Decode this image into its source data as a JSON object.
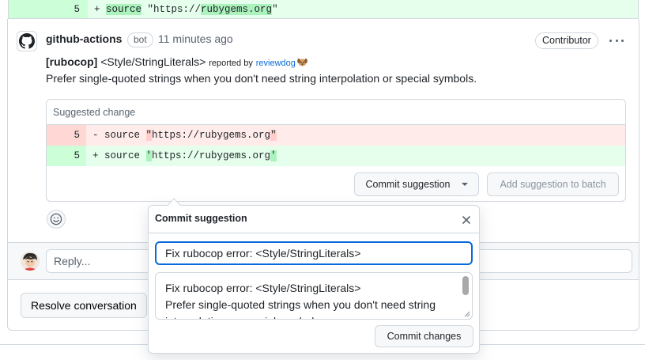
{
  "top_diff": {
    "line": "5",
    "code_prefix": "+ ",
    "code_hl": "source",
    "code_mid": " \"https://",
    "code_hl2": "rubygems.org",
    "code_end": "\""
  },
  "comment": {
    "author": "github-actions",
    "badge": "bot",
    "time": "11 minutes ago",
    "role": "Contributor",
    "rule_bold": "[rubocop]",
    "rule_name": "<Style/StringLiterals>",
    "reported_by": "reported by",
    "reporter": "reviewdog",
    "message": "Prefer single-quoted strings when you don't need string interpolation or special symbols."
  },
  "suggestion": {
    "header": "Suggested change",
    "del": {
      "line": "5",
      "prefix": "- source ",
      "hl": "\"",
      "rest": "https://rubygems.org",
      "hl_end": "\""
    },
    "add": {
      "line": "5",
      "prefix": "+ source ",
      "hl": "'",
      "rest": "https://rubygems.org",
      "hl_end": "'"
    },
    "commit_label": "Commit suggestion",
    "batch_label": "Add suggestion to batch"
  },
  "reply": {
    "placeholder": "Reply...",
    "resolve_label": "Resolve conversation"
  },
  "popover": {
    "title": "Commit suggestion",
    "title_value": "Fix rubocop error:  <Style/StringLiterals>",
    "desc_line1": "Fix rubocop error:  <Style/StringLiterals>",
    "desc_line2": "Prefer single-quoted strings when you don't need string",
    "desc_line3": "interpolation or special symbols.",
    "commit_label": "Commit changes"
  }
}
